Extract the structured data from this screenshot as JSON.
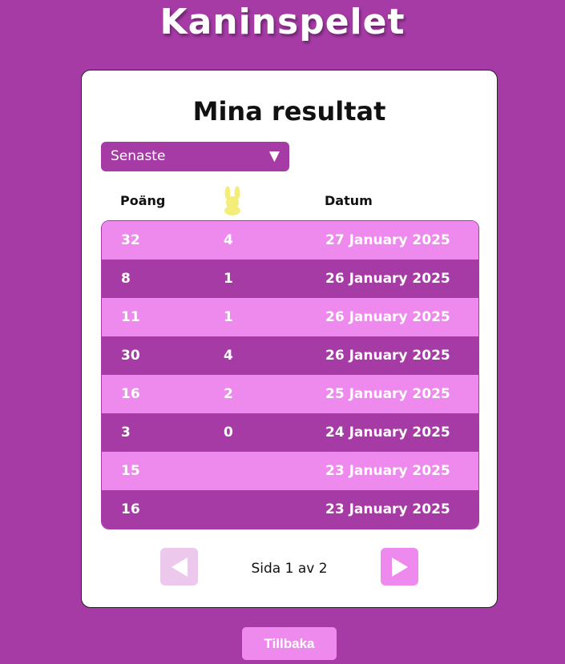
{
  "app": {
    "title": "Kaninspelet"
  },
  "card": {
    "title": "Mina resultat"
  },
  "sort": {
    "selected": "Senaste",
    "arrow": "▼"
  },
  "table": {
    "headers": {
      "points": "Poäng",
      "rabbits_icon": "bunny-icon",
      "date": "Datum"
    },
    "rows": [
      {
        "points": "32",
        "rabbits": "4",
        "date": "27 January 2025"
      },
      {
        "points": "8",
        "rabbits": "1",
        "date": "26 January 2025"
      },
      {
        "points": "11",
        "rabbits": "1",
        "date": "26 January 2025"
      },
      {
        "points": "30",
        "rabbits": "4",
        "date": "26 January 2025"
      },
      {
        "points": "16",
        "rabbits": "2",
        "date": "25 January 2025"
      },
      {
        "points": "3",
        "rabbits": "0",
        "date": "24 January 2025"
      },
      {
        "points": "15",
        "rabbits": "",
        "date": "23 January 2025"
      },
      {
        "points": "16",
        "rabbits": "",
        "date": "23 January 2025"
      }
    ]
  },
  "pagination": {
    "text": "Sida 1 av 2",
    "prev_icon": "triangle-left-icon",
    "next_icon": "triangle-right-icon"
  },
  "footer": {
    "back_label": "Tillbaka"
  },
  "colors": {
    "background": "#a63ba6",
    "light_row": "#ee8aee",
    "dark_row": "#a63ba6",
    "disabled_button": "#ecc9ec",
    "bunny": "#f3ee7a"
  }
}
